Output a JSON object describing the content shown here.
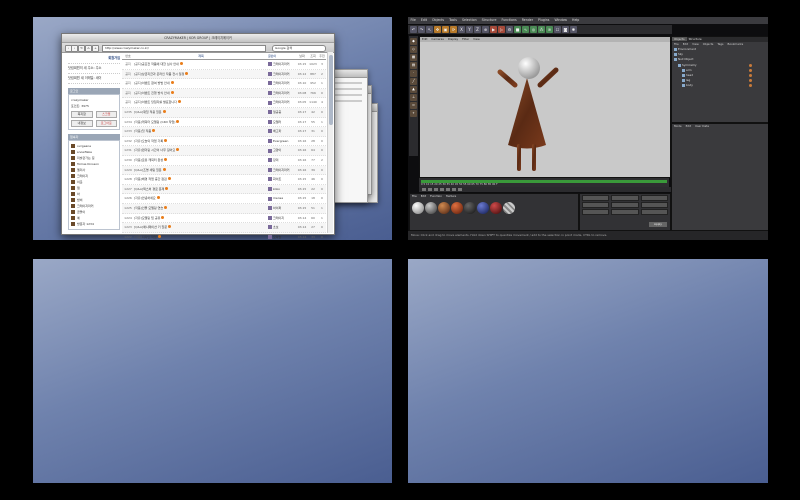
{
  "browser": {
    "window_title": "CRAZYMAKER | KOR GROUP | 크레이지메이커",
    "url": "http://www.crazymaker.co.kr/",
    "search_value": "Google 검색",
    "left_panel": {
      "links": [
        "회원가입",
        "닷컴회원의 새 주소: 주소",
        "닷컴회원 새 이메일: 새이"
      ],
      "login_bar": "로그인",
      "login_lines": [
        "crazymaker",
        "포인트: 3975"
      ],
      "buttons": [
        "쪽지함",
        "스크랩",
        "내정보",
        "로그아웃"
      ],
      "users_bar": "접속자",
      "users": [
        "ovrgeane",
        "snowflake",
        "미술관가는 길",
        "Tomas Kinsson",
        "엘리사",
        "크레이지",
        "이웃",
        "잼",
        "하",
        "밤비",
        "크레이지마커",
        "곰돌이",
        "예",
        "방문자 1234"
      ]
    },
    "list": {
      "headers": [
        "번호",
        "제목",
        "글쓴이",
        "날짜",
        "조회",
        "추천"
      ],
      "rows": [
        {
          "no": "공지",
          "category": "[공지]",
          "title": "공모전 작품에 대한 심사 안내",
          "author": "크레이지마커",
          "date": "03.15",
          "hits": "1023",
          "rec": "3"
        },
        {
          "no": "공지",
          "category": "[공지]",
          "title": "상금지급과 온라인 작품 전시 일정",
          "author": "크레이지마커",
          "date": "03.12",
          "hits": "887",
          "rec": "2"
        },
        {
          "no": "공지",
          "category": "[공지]",
          "title": "이벤트 참여 방법 안내",
          "author": "크레이지마커",
          "date": "03.10",
          "hits": "952",
          "rec": "1"
        },
        {
          "no": "공지",
          "category": "[공지]",
          "title": "이벤트 진행 방식 안내",
          "author": "크레이지마커",
          "date": "03.08",
          "hits": "766",
          "rec": "0"
        },
        {
          "no": "공지",
          "category": "[공지]",
          "title": "이벤트 당첨자를 발표합니다",
          "author": "크레이지마커",
          "date": "03.05",
          "hits": "1140",
          "rec": "4"
        },
        {
          "no": "1235",
          "category": "[Q&A]",
          "title": "재질 적용 질문",
          "author": "열공중",
          "date": "03.17",
          "hits": "42",
          "rec": "0"
        },
        {
          "no": "1234",
          "category": "[작품]",
          "title": "캐릭터 모델링 (C4D 작업)",
          "author": "모델러",
          "date": "03.17",
          "hits": "55",
          "rec": "1"
        },
        {
          "no": "1233",
          "category": "[작품]",
          "title": "첫 작품",
          "author": "배고파",
          "date": "03.17",
          "hits": "31",
          "rec": "0"
        },
        {
          "no": "1232",
          "category": "[자유]",
          "title": "오늘의 작업 기록",
          "author": "Evergreen",
          "date": "03.16",
          "hits": "28",
          "rec": "0"
        },
        {
          "no": "1231",
          "category": "[자유]",
          "title": "렌더링 시간이 너무 길어요",
          "author": "고양이",
          "date": "03.16",
          "hits": "64",
          "rec": "0"
        },
        {
          "no": "1230",
          "category": "[작품]",
          "title": "로봇 캐릭터 완성",
          "author": "장미",
          "date": "03.16",
          "hits": "77",
          "rec": "2"
        },
        {
          "no": "1229",
          "category": "[Q&A]",
          "title": "조명 세팅 질문",
          "author": "크레이지마커",
          "date": "03.16",
          "hits": "39",
          "rec": "0"
        },
        {
          "no": "1228",
          "category": "[작품]",
          "title": "배경 작업 중간 점검",
          "author": "화이트",
          "date": "03.15",
          "hits": "46",
          "rec": "0"
        },
        {
          "no": "1227",
          "category": "[Q&A]",
          "title": "텍스처 경로 문제",
          "author": "koko",
          "date": "03.15",
          "hits": "22",
          "rec": "0"
        },
        {
          "no": "1226",
          "category": "[자유]",
          "title": "안녕하세요",
          "author": "mensa",
          "date": "03.15",
          "hits": "18",
          "rec": "0"
        },
        {
          "no": "1225",
          "category": "[작품]",
          "title": "인물 모델링 연습",
          "author": "하이퍼",
          "date": "03.15",
          "hits": "51",
          "rec": "1"
        },
        {
          "no": "1224",
          "category": "[자유]",
          "title": "모델링 팁 공유",
          "author": "크레이지",
          "date": "03.14",
          "hits": "60",
          "rec": "1"
        },
        {
          "no": "1223",
          "category": "[Q&A]",
          "title": "애니메이션 키 질문",
          "author": "초보",
          "date": "03.14",
          "hits": "27",
          "rec": "0"
        },
        {
          "no": "1222",
          "category": "[작품]",
          "title": "디자인 작업",
          "author": "오하늘",
          "date": "03.14",
          "hits": "33",
          "rec": "0"
        },
        {
          "no": "1221",
          "category": "[자유]",
          "title": "질문 있습니다",
          "author": "박진",
          "date": "03.14",
          "hits": "19",
          "rec": "0"
        },
        {
          "no": "1220",
          "category": "[자유]",
          "title": "오랜만입니다",
          "author": "크레이지마커",
          "date": "03.13",
          "hits": "24",
          "rec": "0"
        }
      ]
    }
  },
  "c4d": {
    "title": "Untitled 1 *",
    "menu": [
      "File",
      "Edit",
      "Objects",
      "Tools",
      "Selection",
      "Structure",
      "Functions",
      "Render",
      "Plugins",
      "Window",
      "Help"
    ],
    "viewport_menu": [
      "Edit",
      "Cameras",
      "Display",
      "Filter",
      "View"
    ],
    "timeline_ticks": "0  5  10  15  20  25  30  35  40  45  50  55  60  65  70  75  80  85  90 F",
    "material_menu": [
      "File",
      "Edit",
      "Function",
      "Texture"
    ],
    "apply_label": "Apply",
    "status_text": "Move: Click and drag to move elements. Hold down SHIFT to quantize movement / add to the selection in point mode, CTRL to remove.",
    "objects_tabs": [
      "Objects",
      "Structure"
    ],
    "objects_menu": [
      "File",
      "Edit",
      "View",
      "Objects",
      "Tags",
      "Bookmarks"
    ],
    "objects": [
      "Environment",
      "Sky",
      "Null Object",
      "Symmetry",
      "arm",
      "head",
      "leg",
      "body"
    ],
    "attributes_menu": [
      "Mode",
      "Edit",
      "User Data"
    ],
    "colors": {
      "figure_dress": "#6a3a1e",
      "figure_head": "#f2f2f2",
      "viewport_bg": "#c9c9c9"
    }
  }
}
